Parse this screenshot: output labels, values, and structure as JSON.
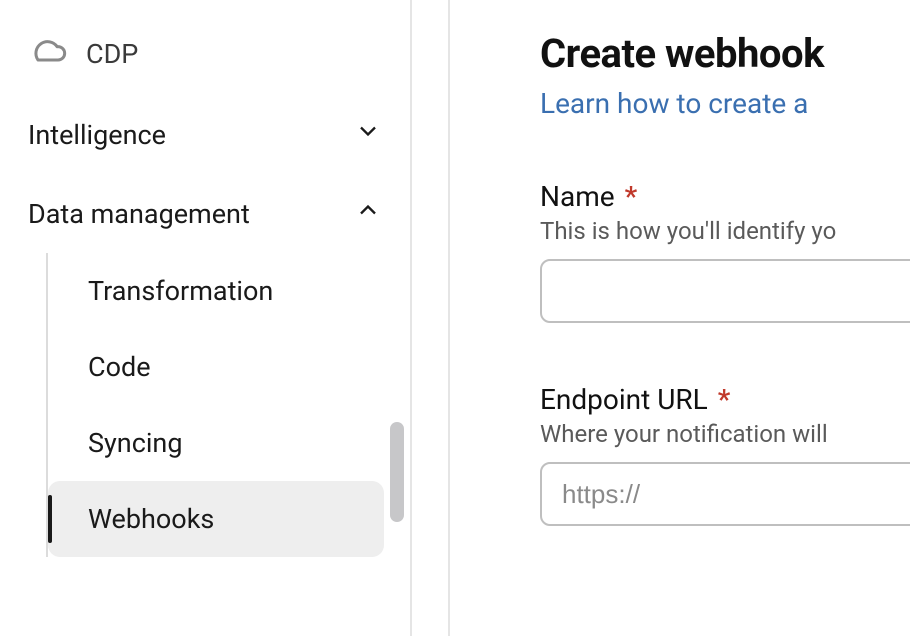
{
  "sidebar": {
    "top_item": {
      "label": "CDP",
      "icon": "cloud-icon"
    },
    "sections": [
      {
        "label": "Intelligence",
        "expanded": false
      },
      {
        "label": "Data management",
        "expanded": true
      }
    ],
    "data_management_items": [
      {
        "label": "Transformation",
        "active": false
      },
      {
        "label": "Code",
        "active": false
      },
      {
        "label": "Syncing",
        "active": false
      },
      {
        "label": "Webhooks",
        "active": true
      }
    ]
  },
  "main": {
    "title": "Create webhook",
    "subtitle_link": "Learn how to create a",
    "fields": {
      "name": {
        "label": "Name",
        "required_mark": "*",
        "help": "This is how you'll identify yo",
        "value": ""
      },
      "endpoint": {
        "label": "Endpoint URL",
        "required_mark": "*",
        "help": "Where your notification will",
        "placeholder": "https://",
        "value": ""
      }
    }
  }
}
